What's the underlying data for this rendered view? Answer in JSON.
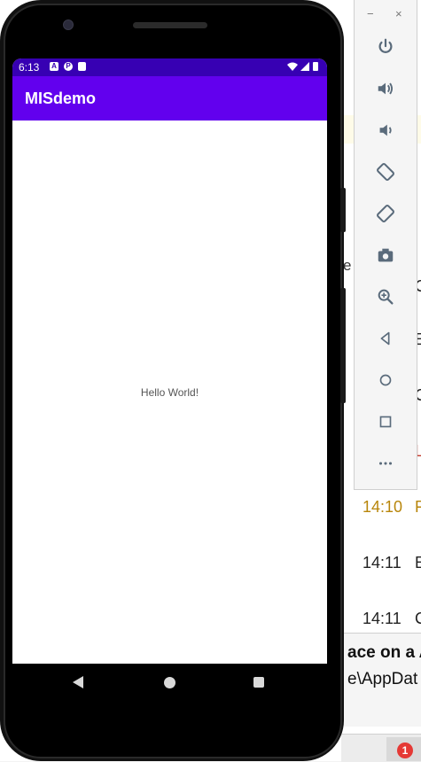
{
  "ide": {
    "clip_text": "e",
    "log_rows": [
      {
        "time": "",
        "text": "C",
        "style": "normal"
      },
      {
        "time": "",
        "text": "E",
        "style": "normal"
      },
      {
        "time": "",
        "text": "C",
        "style": "normal"
      },
      {
        "time": "",
        "text": "L",
        "style": "err"
      },
      {
        "time": "14:10",
        "text": "F",
        "style": "warn"
      },
      {
        "time": "14:11",
        "text": "E",
        "style": "normal"
      },
      {
        "time": "14:11",
        "text": "C",
        "style": "normal"
      }
    ],
    "dialog_title": "ace on a A",
    "dialog_path": "e\\AppDat",
    "notification_count": "1"
  },
  "phone": {
    "status_time": "6:13",
    "status_icons": [
      "A",
      "P",
      "SD"
    ],
    "app_title": "MISdemo",
    "body_text": "Hello World!",
    "colors": {
      "status_bar": "#3700b3",
      "app_bar": "#6200ee"
    }
  },
  "emulator_toolbar": {
    "window_controls": [
      "−",
      "×"
    ],
    "buttons": [
      "power-icon",
      "volume-up-icon",
      "volume-down-icon",
      "rotate-left-icon",
      "rotate-right-icon",
      "camera-icon",
      "zoom-icon",
      "back-icon",
      "home-icon",
      "overview-icon",
      "more-icon"
    ]
  }
}
